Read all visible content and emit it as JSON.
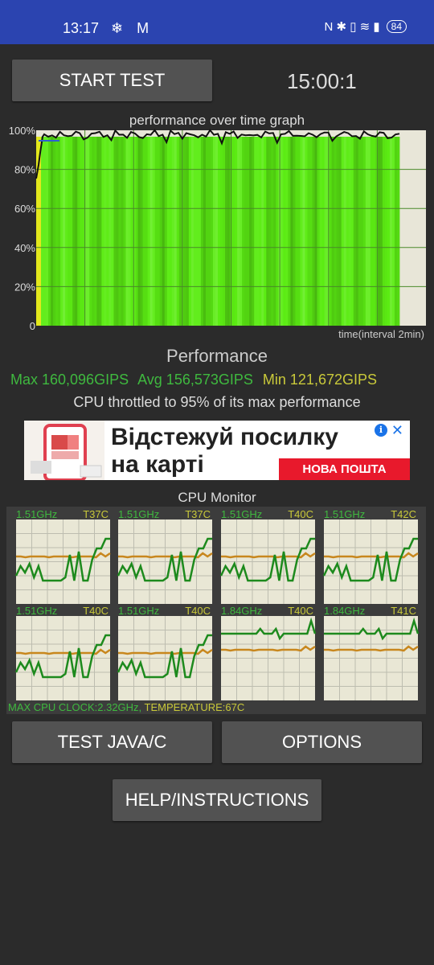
{
  "status_bar": {
    "time": "13:17",
    "left_icons": "❄ M",
    "right_icons": "N ✱ ▯ ≋ ▮",
    "battery": "84"
  },
  "controls": {
    "start_label": "START TEST",
    "timer": "15:00:1",
    "java_label": "TEST JAVA/C",
    "options_label": "OPTIONS",
    "help_label": "HELP/INSTRUCTIONS"
  },
  "graph": {
    "title": "performance over time graph",
    "x_caption": "time(interval 2min)",
    "y_ticks": [
      "100%",
      "80%",
      "60%",
      "40%",
      "20%",
      "0"
    ]
  },
  "performance": {
    "title": "Performance",
    "max": "Max 160,096GIPS",
    "avg": "Avg 156,573GIPS",
    "min": "Min 121,672GIPS",
    "throttle": "CPU throttled to 95% of its max performance"
  },
  "ad": {
    "line1": "Відстежуй посилку",
    "line2": "на карті",
    "brand": "НОВА ПОШТА",
    "info": "i",
    "close": "✕"
  },
  "cpu_monitor": {
    "title": "CPU Monitor",
    "cores": [
      {
        "freq": "1.51GHz",
        "temp": "T37C"
      },
      {
        "freq": "1.51GHz",
        "temp": "T37C"
      },
      {
        "freq": "1.51GHz",
        "temp": "T40C"
      },
      {
        "freq": "1.51GHz",
        "temp": "T42C"
      },
      {
        "freq": "1.51GHz",
        "temp": "T40C"
      },
      {
        "freq": "1.51GHz",
        "temp": "T40C"
      },
      {
        "freq": "1.84GHz",
        "temp": "T40C"
      },
      {
        "freq": "1.84GHz",
        "temp": "T41C"
      }
    ],
    "max_clock": "MAX CPU CLOCK:2.32GHz,",
    "temperature": "TEMPERATURE:67C"
  },
  "colors": {
    "status_bar": "#2b44b0",
    "green_text": "#3fb93f",
    "yellow_text": "#c9c93a",
    "bar_green": "#55e81a",
    "temp_line": "#c8871e",
    "freq_line": "#1d8a1d"
  }
}
